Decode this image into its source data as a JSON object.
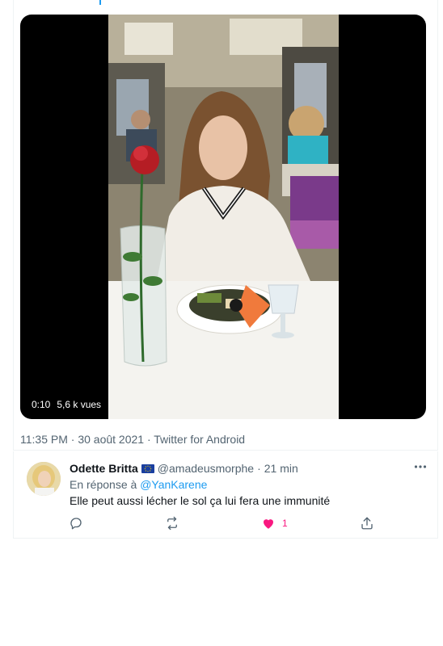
{
  "video": {
    "duration": "0:10",
    "views": "5,6 k vues"
  },
  "tweet": {
    "timestamp": "11:35 PM · 30 août 2021 · Twitter for Android"
  },
  "reply": {
    "author": "Odette Britta",
    "handle": "@amadeusmorphe",
    "separator": "·",
    "time": "21 min",
    "reply_prefix": "En réponse à",
    "reply_to": "@YanKarene",
    "text": "Elle peut aussi lécher le sol ça lui fera une immunité",
    "like_count": "1",
    "flag_icon": "eu-flag-icon",
    "icons": [
      "reply-icon",
      "retweet-icon",
      "like-icon",
      "share-icon",
      "more-icon"
    ]
  },
  "colors": {
    "accent": "#1d9bf0",
    "like": "#f91880",
    "secondary_text": "#536471"
  }
}
